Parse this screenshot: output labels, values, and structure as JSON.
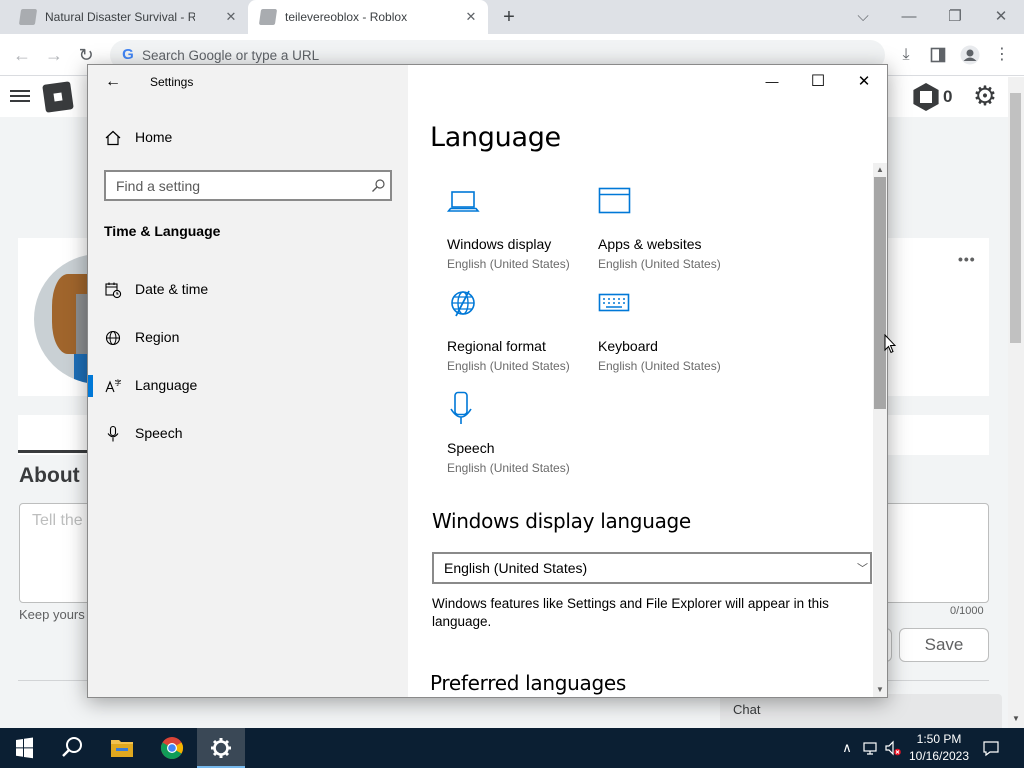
{
  "browser": {
    "tabs": [
      {
        "title": "Natural Disaster Survival - Roblox",
        "close": "✕"
      },
      {
        "title": "teilevereoblox - Roblox",
        "close": "✕"
      }
    ],
    "new_tab": "+",
    "window_controls": {
      "menu": "⌵",
      "minimize": "—",
      "restore": "❐",
      "close": "✕"
    },
    "omnibox_placeholder": "Search Google or type a URL",
    "google_glyph": "G",
    "back": "←",
    "forward": "→",
    "reload": "↻",
    "download_icon": "⤓",
    "menu_icon": "⋮"
  },
  "roblox": {
    "robux": "0",
    "gear": "⚙",
    "more": "•••",
    "about_title": "About",
    "about_placeholder": "Tell the",
    "keep_safe": "Keep yours",
    "char_count": "0/1000",
    "save_label": "Save",
    "chat_label": "Chat"
  },
  "settings": {
    "app_title": "Settings",
    "back": "←",
    "nav_home": "Home",
    "search_placeholder": "Find a setting",
    "section": "Time & Language",
    "nav_items": [
      {
        "label": "Date & time",
        "icon": "calendar-clock-icon"
      },
      {
        "label": "Region",
        "icon": "globe-icon"
      },
      {
        "label": "Language",
        "icon": "language-icon"
      },
      {
        "label": "Speech",
        "icon": "microphone-icon"
      }
    ],
    "active_item": "Language",
    "window_controls": {
      "minimize": "—",
      "maximize": "☐",
      "close": "✕"
    },
    "page_title": "Language",
    "tiles": [
      {
        "label": "Windows display",
        "sub": "English (United States)",
        "icon": "laptop-icon"
      },
      {
        "label": "Apps & websites",
        "sub": "English (United States)",
        "icon": "window-icon"
      },
      {
        "label": "Regional format",
        "sub": "English (United States)",
        "icon": "globe-icon"
      },
      {
        "label": "Keyboard",
        "sub": "English (United States)",
        "icon": "keyboard-icon"
      },
      {
        "label": "Speech",
        "sub": "English (United States)",
        "icon": "microphone-icon"
      }
    ],
    "display_language_heading": "Windows display language",
    "display_language_value": "English (United States)",
    "display_language_desc": "Windows features like Settings and File Explorer will appear in this language.",
    "preferred_heading": "Preferred languages",
    "accent_color": "#0078d7"
  },
  "taskbar": {
    "time": "1:50 PM",
    "date": "10/16/2023",
    "tray_chevron": "∧"
  }
}
